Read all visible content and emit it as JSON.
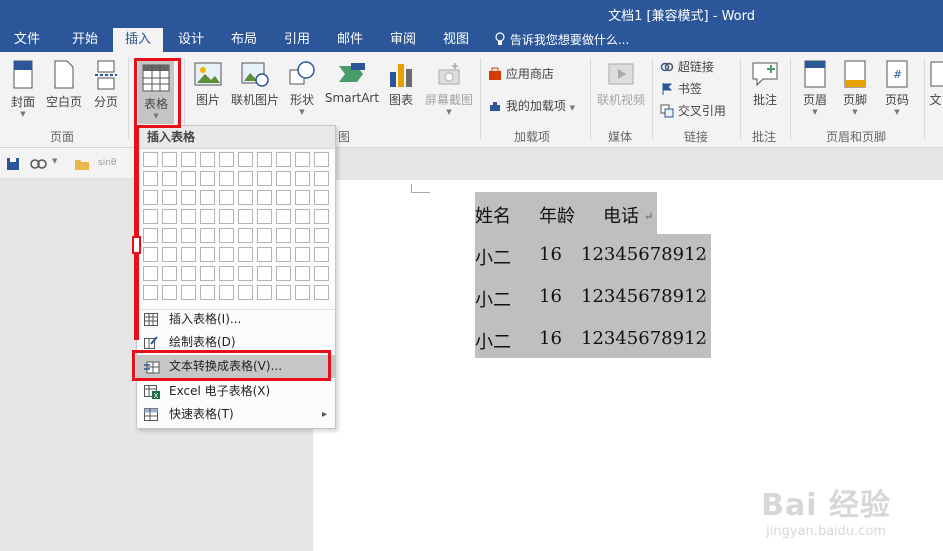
{
  "window": {
    "title": "文档1 [兼容模式] - Word"
  },
  "tabs": [
    {
      "label": "文件"
    },
    {
      "label": "开始"
    },
    {
      "label": "插入"
    },
    {
      "label": "设计"
    },
    {
      "label": "布局"
    },
    {
      "label": "引用"
    },
    {
      "label": "邮件"
    },
    {
      "label": "审阅"
    },
    {
      "label": "视图"
    }
  ],
  "tell_me": "告诉我您想要做什么...",
  "ribbon": {
    "pages": {
      "cover": "封面",
      "blank": "空白页",
      "break": "分页",
      "group": "页面"
    },
    "table": {
      "label": "表格",
      "group": "表格"
    },
    "illustrations": {
      "picture": "图片",
      "online_picture": "联机图片",
      "shapes": "形状",
      "smartart": "SmartArt",
      "chart": "图表",
      "screenshot": "屏幕截图",
      "group_tail": "图"
    },
    "addins": {
      "store": "应用商店",
      "my_addins": "我的加载项",
      "group": "加载项"
    },
    "media": {
      "online_video": "联机视频",
      "group": "媒体"
    },
    "links": {
      "hyperlink": "超链接",
      "bookmark": "书签",
      "cross_ref": "交叉引用",
      "group": "链接"
    },
    "comments": {
      "comment": "批注",
      "group": "批注"
    },
    "header_footer": {
      "header": "页眉",
      "footer": "页脚",
      "page_number": "页码",
      "group": "页眉和页脚"
    },
    "text": {
      "partial": "文"
    }
  },
  "qat": {
    "style_hint": "sinθ"
  },
  "table_menu": {
    "header": "插入表格",
    "grid": {
      "cols": 10,
      "rows": 8
    },
    "items": [
      {
        "label": "插入表格(I)...",
        "icon": "table-icon"
      },
      {
        "label": "绘制表格(D)",
        "icon": "pencil-table-icon"
      },
      {
        "label": "文本转换成表格(V)...",
        "icon": "text-to-table-icon"
      },
      {
        "label": "Excel 电子表格(X)",
        "icon": "excel-icon"
      },
      {
        "label": "快速表格(T)",
        "icon": "quick-table-icon",
        "submenu_arrow": "▸"
      }
    ]
  },
  "document": {
    "rows": [
      [
        "姓名",
        "年龄",
        "电话"
      ],
      [
        "小二",
        "16",
        "12345678912"
      ],
      [
        "小二",
        "16",
        "12345678912"
      ],
      [
        "小二",
        "16",
        "12345678912"
      ]
    ],
    "paragraph_mark": "↵"
  },
  "watermark": {
    "brand": "Bai 经验",
    "url": "jingyan.baidu.com"
  },
  "colors": {
    "accent": "#2b579a",
    "highlight": "#e5101a",
    "selection": "#bfbfbf"
  }
}
